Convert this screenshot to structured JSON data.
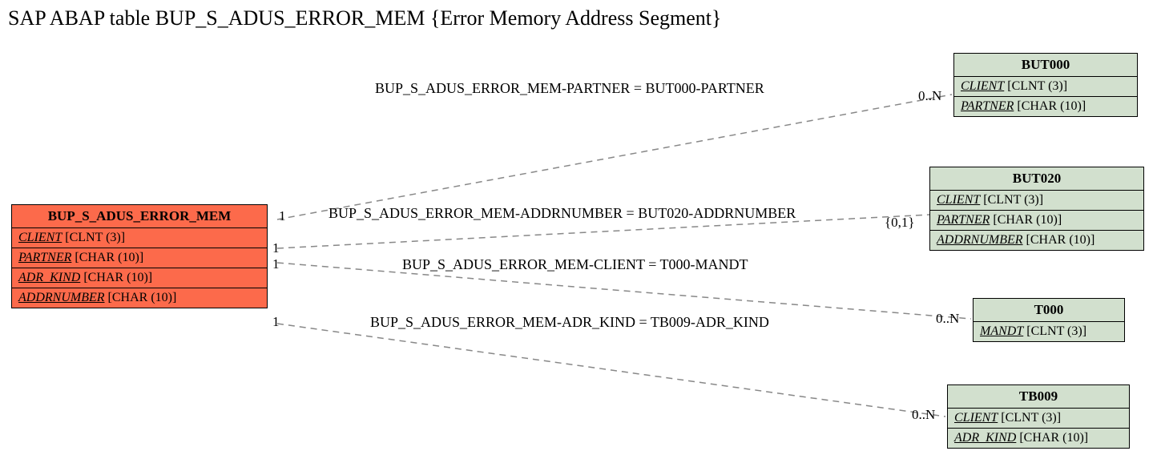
{
  "title": "SAP ABAP table BUP_S_ADUS_ERROR_MEM {Error Memory Address Segment}",
  "main": {
    "name": "BUP_S_ADUS_ERROR_MEM",
    "fields": [
      {
        "f": "CLIENT",
        "t": " [CLNT (3)]"
      },
      {
        "f": "PARTNER",
        "t": " [CHAR (10)]"
      },
      {
        "f": "ADR_KIND",
        "t": " [CHAR (10)]"
      },
      {
        "f": "ADDRNUMBER",
        "t": " [CHAR (10)]"
      }
    ]
  },
  "refs": {
    "but000": {
      "name": "BUT000",
      "fields": [
        {
          "f": "CLIENT",
          "t": " [CLNT (3)]"
        },
        {
          "f": "PARTNER",
          "t": " [CHAR (10)]"
        }
      ]
    },
    "but020": {
      "name": "BUT020",
      "fields": [
        {
          "f": "CLIENT",
          "t": " [CLNT (3)]"
        },
        {
          "f": "PARTNER",
          "t": " [CHAR (10)]"
        },
        {
          "f": "ADDRNUMBER",
          "t": " [CHAR (10)]"
        }
      ]
    },
    "t000": {
      "name": "T000",
      "fields": [
        {
          "f": "MANDT",
          "t": " [CLNT (3)]"
        }
      ]
    },
    "tb009": {
      "name": "TB009",
      "fields": [
        {
          "f": "CLIENT",
          "t": " [CLNT (3)]"
        },
        {
          "f": "ADR_KIND",
          "t": " [CHAR (10)]"
        }
      ]
    }
  },
  "rels": {
    "r1": "BUP_S_ADUS_ERROR_MEM-PARTNER = BUT000-PARTNER",
    "r2": "BUP_S_ADUS_ERROR_MEM-ADDRNUMBER = BUT020-ADDRNUMBER",
    "r3": "BUP_S_ADUS_ERROR_MEM-CLIENT = T000-MANDT",
    "r4": "BUP_S_ADUS_ERROR_MEM-ADR_KIND = TB009-ADR_KIND"
  },
  "cards": {
    "c1l": "1",
    "c1r": "0..N",
    "c2l": "1",
    "c2r": "{0,1}",
    "c3l": "1",
    "c3r": "0..N",
    "c4l": "1",
    "c4r": "0..N"
  }
}
